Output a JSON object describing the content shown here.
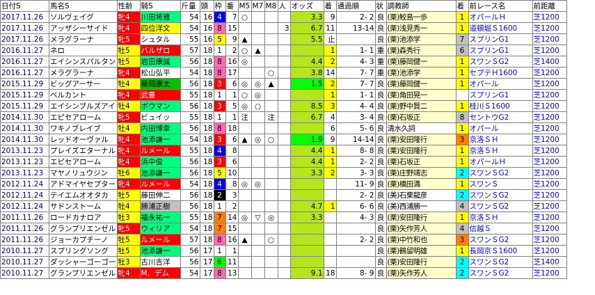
{
  "columns": [
    {
      "key": "date",
      "label": "日付S"
    },
    {
      "key": "horse",
      "label": "馬名S"
    },
    {
      "key": "sexage",
      "label": "性齢"
    },
    {
      "key": "jockey",
      "label": "騎S"
    },
    {
      "key": "weight",
      "label": "斤量"
    },
    {
      "key": "heads",
      "label": "頭"
    },
    {
      "key": "waku",
      "label": "枠"
    },
    {
      "key": "num",
      "label": "番"
    },
    {
      "key": "m5",
      "label": "M5"
    },
    {
      "key": "m7",
      "label": "M7"
    },
    {
      "key": "m8",
      "label": "M8"
    },
    {
      "key": "pop",
      "label": "人"
    },
    {
      "key": "odds",
      "label": "オッズ"
    },
    {
      "key": "finish",
      "label": "着"
    },
    {
      "key": "passing",
      "label": "通過順"
    },
    {
      "key": "going",
      "label": "状"
    },
    {
      "key": "trainer",
      "label": "調教師"
    },
    {
      "key": "prev_finish",
      "label": "着"
    },
    {
      "key": "prev_race",
      "label": "前レース名"
    },
    {
      "key": "prev_dist",
      "label": "前距離"
    }
  ],
  "colors": {
    "sex_male": "#ffff00",
    "sex_female": "#ff0000",
    "waku": [
      "#ffffff",
      "#ffffff",
      "#000000",
      "#ff0000",
      "#0000ff",
      "#ffff00",
      "#00ff00",
      "#ff8000",
      "#ff69b4"
    ],
    "waku_text": [
      "#000000",
      "#000000",
      "#ffffff",
      "#ffffff",
      "#ffffff",
      "#000000",
      "#000000",
      "#000000",
      "#000000"
    ],
    "odds_bg": "#b5e61d",
    "odds_bg_dark": "#b5e61d",
    "odds_fav": "#00ff00",
    "finish_top": "#ffff00",
    "pop_bg": "#ffffff",
    "trainer_ritto": "#ffffcc",
    "trainer_miho": "#ffffff",
    "prev_finish_1": "#ffff00",
    "prev_finish_2": "#00ffff",
    "prev_finish_3": "#ff8000",
    "prev_finish_other": "#c0c0c0",
    "prev_race_turf": "#ffffff",
    "dist_turf": "#ffffff",
    "jockey_top": "#00ff7f",
    "jockey_foreign": "#ff0000",
    "jockey_gray": "#c0c0c0",
    "jockey_green": "#00c000"
  },
  "rows": [
    {
      "date": "2017.11.26",
      "horse": "ソルヴェイグ",
      "sexage": "牝4",
      "jockey": "川田将雅",
      "jockey_style": "top",
      "weight": "54",
      "heads": "16",
      "waku": "4",
      "num": "7",
      "m5": "○",
      "m7": "",
      "m8": "",
      "pop": "",
      "odds": "3.3",
      "finish": "9",
      "passing": "2- 2",
      "going": "良",
      "trainer": "(栗)鮫島一歩",
      "prev_finish": "1",
      "prev_race": "オパールＨ",
      "prev_dist": "芝1200"
    },
    {
      "date": "2017.11.26",
      "horse": "アッザシーサイド",
      "sexage": "牝4",
      "jockey": "四位洋文",
      "jockey_style": "yellow",
      "weight": "54",
      "heads": "16",
      "waku": "8",
      "num": "15",
      "m5": "",
      "m7": "",
      "m8": "",
      "pop": "3",
      "odds": "6.7",
      "finish": "11",
      "passing": "13-14",
      "going": "良",
      "trainer": "(栗)浅見秀一",
      "prev_finish": "1",
      "prev_race": "道頓堀Ｓ1600",
      "prev_dist": "芝1200"
    },
    {
      "date": "2017.11.26",
      "horse": "メラグラーナ",
      "sexage": "牝5",
      "jockey": "シュタル",
      "jockey_style": "none",
      "weight": "55",
      "heads": "16",
      "waku": "5",
      "num": "9",
      "m5": "▲",
      "m7": "",
      "m8": "",
      "pop": "",
      "odds": "5.5",
      "finish": "止",
      "passing": "",
      "going": "良",
      "trainer": "(栗)池添学",
      "prev_finish": "7",
      "prev_race": "スプリンG1",
      "prev_dist": "芝1200"
    },
    {
      "date": "2016.11.27",
      "horse": "ネロ",
      "sexage": "牡5",
      "jockey": "バルザロ",
      "jockey_style": "red",
      "weight": "57",
      "heads": "18",
      "waku": "1",
      "num": "2",
      "m5": "○",
      "m7": "▲",
      "m8": "",
      "pop": "",
      "odds": "",
      "finish": "1",
      "passing": "1- 1",
      "going": "重",
      "trainer": "(栗)森秀行",
      "prev_finish": "6",
      "prev_race": "スプリンG1",
      "prev_dist": "芝1200"
    },
    {
      "date": "2016.11.27",
      "horse": "エイシンスパルタン",
      "sexage": "牡5",
      "jockey": "岩田康誠",
      "jockey_style": "top",
      "weight": "56",
      "heads": "18",
      "waku": "8",
      "num": "16",
      "m5": "◎",
      "m7": "",
      "m8": "",
      "pop": "",
      "odds": "4.4",
      "finish": "2",
      "passing": "4- 3",
      "going": "重",
      "trainer": "(栗)藤岡健一",
      "prev_finish": "1",
      "prev_race": "スワンＳG2",
      "prev_dist": "芝1400"
    },
    {
      "date": "2016.11.27",
      "horse": "メラグラーナ",
      "sexage": "牝4",
      "jockey": "松山弘平",
      "jockey_style": "none",
      "weight": "54",
      "heads": "18",
      "waku": "8",
      "num": "17",
      "m5": "",
      "m7": "",
      "m8": "○",
      "pop": "",
      "odds": "3.8",
      "finish": "14",
      "passing": "7- 7",
      "going": "重",
      "trainer": "(栗)池添学",
      "prev_finish": "1",
      "prev_race": "セプテＨ1600",
      "prev_dist": "芝1200"
    },
    {
      "date": "2015.11.29",
      "horse": "ビッグアーサー",
      "sexage": "牡4",
      "jockey": "藤岡康太",
      "jockey_style": "green",
      "weight": "56",
      "heads": "18",
      "waku": "3",
      "num": "6",
      "m5": "◎",
      "m7": "◎",
      "m8": "▲",
      "pop": "",
      "odds": "1.5",
      "finish": "2",
      "passing": "7- 7",
      "going": "良",
      "trainer": "(栗)藤岡健一",
      "prev_finish": "1",
      "prev_race": "オパール",
      "prev_dist": "芝1200"
    },
    {
      "date": "2015.11.29",
      "horse": "ベルカント",
      "sexage": "牝4",
      "jockey": "武豊",
      "jockey_style": "red",
      "weight": "55",
      "heads": "18",
      "waku": "1",
      "num": "1",
      "m5": "○",
      "m7": "◎",
      "m8": "",
      "pop": "",
      "odds": "",
      "finish": "1",
      "passing": "1- 1",
      "going": "良",
      "trainer": "(栗)角田晃一",
      "prev_finish": "",
      "prev_race": "スプリンG1",
      "prev_dist": "芝1200"
    },
    {
      "date": "2015.11.29",
      "horse": "エイシンブルズアイ",
      "sexage": "牡4",
      "jockey": "ボウマン",
      "jockey_style": "top",
      "weight": "56",
      "heads": "18",
      "waku": "3",
      "num": "5",
      "m5": "◎",
      "m7": "○",
      "m8": "",
      "pop": "",
      "odds": "8.5",
      "finish": "3",
      "passing": "4- 4",
      "going": "良",
      "trainer": "(栗)野中賢二",
      "prev_finish": "1",
      "prev_race": "桂川Ｓ1600",
      "prev_dist": "芝1200"
    },
    {
      "date": "2014.11.30",
      "horse": "エピセアローム",
      "sexage": "牝5",
      "jockey": "ビュイッ",
      "jockey_style": "none",
      "weight": "55",
      "heads": "18",
      "waku": "1",
      "num": "1",
      "m5": "注",
      "m7": "",
      "m8": "注",
      "pop": "",
      "odds": "6.7",
      "finish": "4",
      "passing": "3- 4",
      "going": "良",
      "trainer": "(栗)石坂正",
      "prev_finish": "8",
      "prev_race": "セントウG2",
      "prev_dist": "芝1200"
    },
    {
      "date": "2014.11.30",
      "horse": "ワキノブレイブ",
      "sexage": "牡4",
      "jockey": "内田博幸",
      "jockey_style": "top",
      "weight": "56",
      "heads": "18",
      "waku": "8",
      "num": "18",
      "m5": "",
      "m7": "",
      "m8": "",
      "pop": "",
      "odds": "",
      "finish": "6",
      "passing": "5- 6",
      "going": "良",
      "trainer": "清水久詞",
      "prev_finish": "1",
      "prev_race": "オパール",
      "prev_dist": "芝1200"
    },
    {
      "date": "2014.11.30",
      "horse": "レッドオーヴァル",
      "sexage": "牝4",
      "jockey": "池添謙一",
      "jockey_style": "top",
      "weight": "54",
      "heads": "18",
      "waku": "3",
      "num": "6",
      "m5": "▲",
      "m7": "◎",
      "m8": "○",
      "pop": "",
      "odds": "1.9",
      "finish": "9",
      "passing": "14-14",
      "going": "良",
      "trainer": "(栗)安田隆行",
      "prev_finish": "3",
      "prev_race": "京洛ＳＨ",
      "prev_dist": "芝1200"
    },
    {
      "date": "2013.11.23",
      "horse": "プレイズエターナル",
      "sexage": "牝4",
      "jockey": "ルメール",
      "jockey_style": "red",
      "weight": "55",
      "heads": "18",
      "waku": "4",
      "num": "8",
      "m5": "",
      "m7": "",
      "m8": "",
      "pop": "",
      "odds": "4.4",
      "finish": "1",
      "passing": "8- 8",
      "going": "良",
      "trainer": "(栗)安田隆行",
      "prev_finish": "1",
      "prev_race": "京洛ＳＨ",
      "prev_dist": "芝1200"
    },
    {
      "date": "2013.11.23",
      "horse": "エピセアローム",
      "sexage": "牝4",
      "jockey": "浜中俊",
      "jockey_style": "top",
      "weight": "56",
      "heads": "18",
      "waku": "3",
      "num": "6",
      "m5": "",
      "m7": "",
      "m8": "",
      "pop": "",
      "odds": "4.4",
      "finish": "1",
      "passing": "2- 2",
      "going": "良",
      "trainer": "(栗)石坂正",
      "prev_finish": "1",
      "prev_race": "オパールＨ",
      "prev_dist": "芝1200"
    },
    {
      "date": "2013.11.23",
      "horse": "マヤノリュウジン",
      "sexage": "牡6",
      "jockey": "池添謙一",
      "jockey_style": "top",
      "weight": "56",
      "heads": "18",
      "waku": "5",
      "num": "10",
      "m5": "",
      "m7": "",
      "m8": "",
      "pop": "",
      "odds": "3.3",
      "finish": "2",
      "passing": "3- 3",
      "going": "良",
      "trainer": "(栗)庄野靖志",
      "prev_finish": "2",
      "prev_race": "スワンＳG2",
      "prev_dist": "芝1200"
    },
    {
      "date": "2012.11.24",
      "horse": "アドマイヤセプター",
      "sexage": "牝4",
      "jockey": "ルメール",
      "jockey_style": "red",
      "weight": "54",
      "heads": "18",
      "waku": "4",
      "num": "8",
      "m5": "◎",
      "m7": "◎",
      "m8": "",
      "pop": "",
      "odds": "",
      "finish": "",
      "passing": "11- 9",
      "going": "良",
      "trainer": "(栗)橋田満",
      "prev_finish": "1",
      "prev_race": "スワンＳ",
      "prev_dist": "芝1200"
    },
    {
      "date": "2012.11.24",
      "horse": "テイエムオオタカ",
      "sexage": "牡5",
      "jockey": "藤田伸二",
      "jockey_style": "none",
      "weight": "56",
      "heads": "18",
      "waku": "2",
      "num": "3",
      "m5": "",
      "m7": "",
      "m8": "",
      "pop": "",
      "odds": "",
      "finish": "",
      "passing": "2- 2",
      "going": "良",
      "trainer": "(美)石栗龍彦",
      "prev_finish": "2",
      "prev_race": "スワンＳG2",
      "prev_dist": "芝1200"
    },
    {
      "date": "2012.11.24",
      "horse": "サドンストーム",
      "sexage": "牡4",
      "jockey": "勝浦正樹",
      "jockey_style": "gray",
      "weight": "56",
      "heads": "18",
      "waku": "1",
      "num": "2",
      "m5": "",
      "m7": "",
      "m8": "",
      "pop": "",
      "odds": "4.7",
      "finish": "1",
      "passing": "6- 6",
      "going": "良",
      "trainer": "(美)西浦勝一",
      "prev_finish": "4",
      "prev_race": "スワンＳG2",
      "prev_dist": "芝1200"
    },
    {
      "date": "2011.11.26",
      "horse": "ロードカナロア",
      "sexage": "牡3",
      "jockey": "福永祐一",
      "jockey_style": "top",
      "weight": "55",
      "heads": "18",
      "waku": "7",
      "num": "14",
      "m5": "◎",
      "m7": "▽",
      "m8": "◎",
      "pop": "",
      "odds": "3.3",
      "finish": "",
      "passing": "4- 3",
      "going": "良",
      "trainer": "(栗)安田隆行",
      "prev_finish": "1",
      "prev_race": "京洛ＳＨ",
      "prev_dist": "芝1200"
    },
    {
      "date": "2011.11.26",
      "horse": "グランプリエンゼル",
      "sexage": "牝5",
      "jockey": "ウィリア",
      "jockey_style": "top",
      "weight": "54",
      "heads": "18",
      "waku": "7",
      "num": "15",
      "m5": "",
      "m7": "",
      "m8": "",
      "pop": "",
      "odds": "",
      "finish": "",
      "passing": "",
      "going": "良",
      "trainer": "(栗)矢作芳人",
      "prev_finish": "4",
      "prev_race": "信越Ｓ",
      "prev_dist": "芝1200"
    },
    {
      "date": "2011.11.26",
      "horse": "ジョーカプチーノ",
      "sexage": "牡5",
      "jockey": "ルメール",
      "jockey_style": "red",
      "weight": "57",
      "heads": "18",
      "waku": "8",
      "num": "16",
      "m5": "▲",
      "m7": "",
      "m8": "○",
      "pop": "",
      "odds": "",
      "finish": "",
      "passing": "2- 2",
      "going": "良",
      "trainer": "(栗)中竹和也",
      "prev_finish": "3",
      "prev_race": "スワンＳG2",
      "prev_dist": "芝1200"
    },
    {
      "date": "2010.11.27",
      "horse": "スプリングソング",
      "sexage": "牡5",
      "jockey": "池添謙一",
      "jockey_style": "top",
      "weight": "56",
      "heads": "17",
      "waku": "1",
      "num": "1",
      "m5": "",
      "m7": "",
      "m8": "",
      "pop": "",
      "odds": "",
      "finish": "",
      "passing": "",
      "going": "良",
      "trainer": "(栗)鶴留明雄",
      "prev_finish": "1",
      "prev_race": "長岡京Ｓ1600",
      "prev_dist": "芝1200"
    },
    {
      "date": "2010.11.27",
      "horse": "ダッシャーゴーゴー",
      "sexage": "牡3",
      "jockey": "古川吉洋",
      "jockey_style": "none",
      "weight": "56",
      "heads": "17",
      "waku": "6",
      "num": "11",
      "m5": "",
      "m7": "",
      "m8": "",
      "pop": "",
      "odds": "",
      "finish": "",
      "passing": "",
      "going": "良",
      "trainer": "(栗)安田隆行",
      "prev_finish": "2",
      "prev_race": "スワンＳG2",
      "prev_dist": "芝1400"
    },
    {
      "date": "2010.11.27",
      "horse": "グランプリエンゼル",
      "sexage": "牝4",
      "jockey": "M．デム",
      "jockey_style": "red",
      "weight": "54",
      "heads": "17",
      "waku": "8",
      "num": "13",
      "m5": "",
      "m7": "",
      "m8": "",
      "pop": "",
      "odds": "9.1",
      "finish": "18",
      "passing": "8- 9",
      "going": "良",
      "trainer": "(栗)矢作芳人",
      "prev_finish": "2",
      "prev_race": "スワンＳG2",
      "prev_dist": "芝1200"
    }
  ]
}
